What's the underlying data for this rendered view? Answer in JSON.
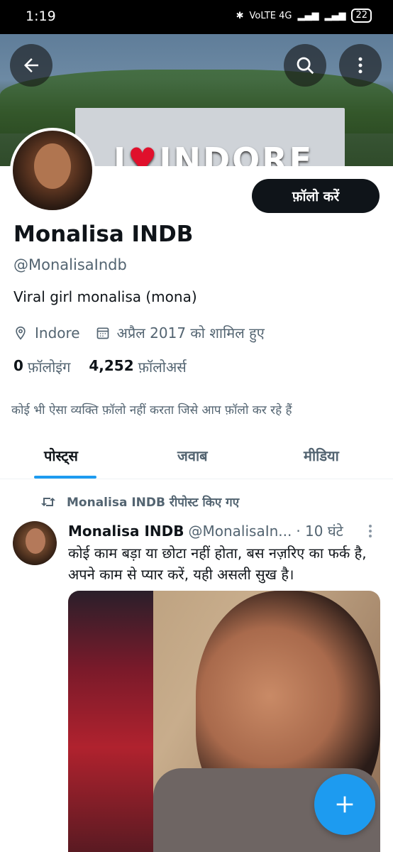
{
  "status_bar": {
    "time": "1:19",
    "network": "VoLTE 4G",
    "battery": "22"
  },
  "banner": {
    "sign_text_i": "I",
    "sign_text_place": "INDORE",
    "heart": "♥"
  },
  "header_actions": {
    "back_icon": "arrow-left-icon",
    "search_icon": "search-icon",
    "more_icon": "more-vertical-icon"
  },
  "profile": {
    "follow_label": "फ़ॉलो करें",
    "name": "Monalisa INDB",
    "handle": "@MonalisaIndb",
    "bio": "Viral girl monalisa (mona)",
    "location": "Indore",
    "joined": "अप्रैल 2017 को शामिल हुए",
    "following_count": "0",
    "following_label": "फ़ॉलोइंग",
    "followers_count": "4,252",
    "followers_label": "फ़ॉलोअर्स",
    "no_mutuals": "कोई भी ऐसा व्यक्ति फ़ॉलो नहीं करता जिसे आप फ़ॉलो कर रहे हैं"
  },
  "tabs": [
    {
      "label": "पोस्ट्स",
      "active": true
    },
    {
      "label": "जवाब",
      "active": false
    },
    {
      "label": "मीडिया",
      "active": false
    }
  ],
  "feed": {
    "repost_label": "Monalisa INDB रीपोस्ट किए गए",
    "tweet": {
      "name": "Monalisa INDB",
      "handle": "@MonalisaIn...",
      "time": "· 10 घंटे",
      "text": "कोई काम बड़ा या छोटा नहीं होता, बस नज़रिए का फर्क है, अपने काम से प्यार करें, यही असली सुख है।"
    }
  },
  "fab": {
    "icon": "plus-icon"
  },
  "colors": {
    "accent": "#1d9bf0",
    "text": "#0f1419",
    "muted": "#536471",
    "button_dark": "#0f1419"
  }
}
